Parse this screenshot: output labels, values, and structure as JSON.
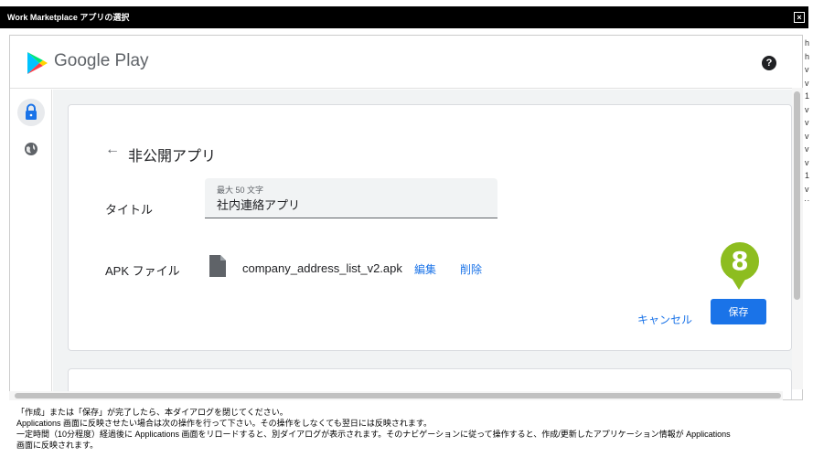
{
  "window": {
    "title": "Work Marketplace アプリの選択",
    "close_label": "×"
  },
  "header": {
    "brand": "Google Play",
    "help_label": "?"
  },
  "page": {
    "back_arrow": "←",
    "title": "非公開アプリ"
  },
  "form": {
    "title_label": "タイトル",
    "title_hint": "最大 50 文字",
    "title_value": "社内連絡アプリ",
    "apk_label": "APK ファイル",
    "apk_filename": "company_address_list_v2.apk",
    "edit_label": "編集",
    "delete_label": "削除"
  },
  "actions": {
    "cancel_label": "キャンセル",
    "save_label": "保存"
  },
  "marker": {
    "step": "8",
    "color": "#8dbd1f"
  },
  "note": {
    "line1": "「作成」または「保存」が完了したら、本ダイアログを閉じてください。",
    "line2": "Applications 画面に反映させたい場合は次の操作を行って下さい。その操作をしなくても翌日には反映されます。",
    "line3": "一定時間（10分程度）経過後に Applications 画面をリロードすると、別ダイアログが表示されます。そのナビゲーションに従って操作すると、作成/更新したアプリケーション情報が Applications",
    "line4": "画面に反映されます。"
  },
  "right_edge_text": "h\nh\nv\nv\n1\nv\nv\nv\nv\nv\n1\nv\nv",
  "colors": {
    "accent": "#1a73e8",
    "titlebar": "#000000"
  },
  "icons": {
    "nav_private": "lock-icon",
    "nav_public": "globe-icon",
    "file": "file-icon"
  }
}
